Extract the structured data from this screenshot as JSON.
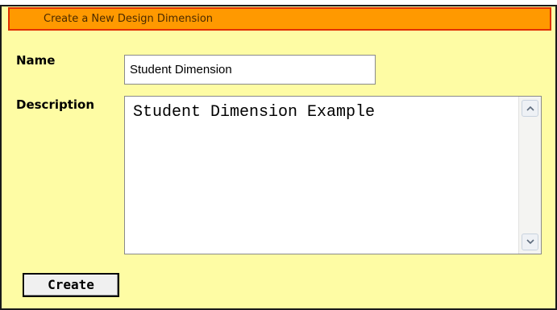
{
  "form": {
    "title": "Create a New Design Dimension",
    "name_label": "Name",
    "name_value": "Student Dimension",
    "description_label": "Description",
    "description_value": "Student Dimension Example",
    "create_label": "Create"
  },
  "colors": {
    "panel_background": "#fefca4",
    "title_bar_fill": "#ff9900",
    "title_bar_border": "#e03000"
  },
  "icons": {
    "scroll_up": "chevron-up-icon",
    "scroll_down": "chevron-down-icon"
  }
}
